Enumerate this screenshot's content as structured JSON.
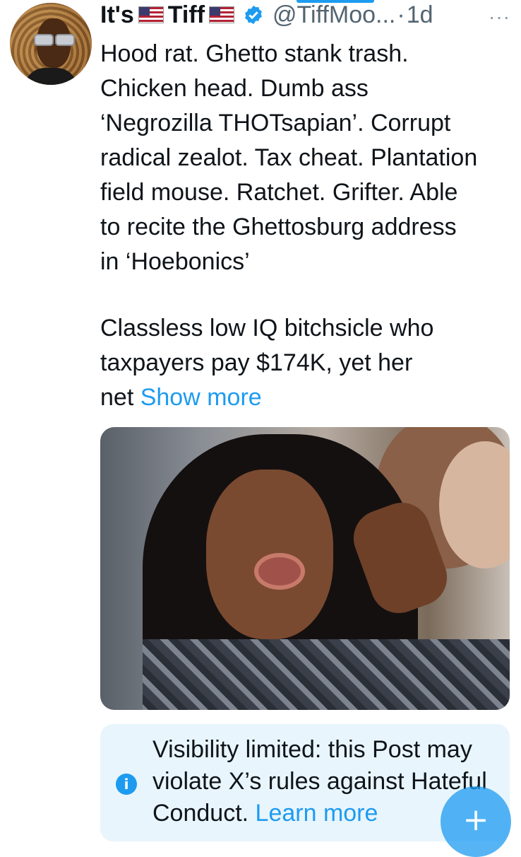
{
  "author": {
    "name_prefix": "It's",
    "name_suffix": "Tiff",
    "handle": "@TiffMoo...",
    "separator": "·",
    "time": "1d",
    "verified": true,
    "flags": [
      "us-flag",
      "us-flag"
    ]
  },
  "more_menu": {
    "icon": "more-horizontal-icon",
    "label": "···"
  },
  "tweet": {
    "lines": [
      "Hood rat. Ghetto stank trash.",
      "Chicken head. Dumb ass",
      "‘Negrozilla THOTsapian’. Corrupt",
      "radical zealot. Tax cheat. Plantation",
      "field mouse. Ratchet. Grifter. Able",
      "to recite the Ghettosburg address",
      "in ‘Hoebonics’"
    ],
    "paragraph2_lines": [
      "Classless low IQ bitchsicle who",
      "taxpayers pay $174K, yet her"
    ],
    "last_word": "net",
    "show_more": "Show more"
  },
  "notice": {
    "icon": "info-icon",
    "text": "Visibility limited: this Post may violate X’s rules against Hateful Conduct.",
    "learn_more": "Learn more"
  },
  "fab": {
    "icon": "plus-icon",
    "label": "+"
  },
  "colors": {
    "accent": "#1d9bf0",
    "notice_bg": "#e8f5fd",
    "text": "#0f1419",
    "muted": "#536471"
  }
}
